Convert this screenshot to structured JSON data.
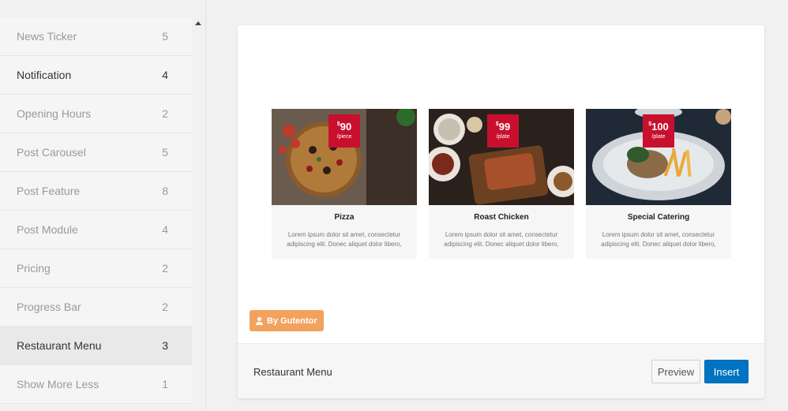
{
  "sidebar": {
    "items": [
      {
        "label": "News Ticker",
        "count": "5"
      },
      {
        "label": "Notification",
        "count": "4"
      },
      {
        "label": "Opening Hours",
        "count": "2"
      },
      {
        "label": "Post Carousel",
        "count": "5"
      },
      {
        "label": "Post Feature",
        "count": "8"
      },
      {
        "label": "Post Module",
        "count": "4"
      },
      {
        "label": "Pricing",
        "count": "2"
      },
      {
        "label": "Progress Bar",
        "count": "2"
      },
      {
        "label": "Restaurant Menu",
        "count": "3"
      },
      {
        "label": "Show More Less",
        "count": "1"
      }
    ],
    "active_item": "Restaurant Menu"
  },
  "preview": {
    "menu_items": [
      {
        "title": "Pizza",
        "currency": "$",
        "price": "90",
        "unit": "/piece",
        "description": "Lorem ipsum dolor sit amet, consectetur adipiscing elit. Donec aliquet dolor libero,"
      },
      {
        "title": "Roast Chicken",
        "currency": "$",
        "price": "99",
        "unit": "/plate",
        "description": "Lorem ipsum dolor sit amet, consectetur adipiscing elit. Donec aliquet dolor libero,"
      },
      {
        "title": "Special Catering",
        "currency": "$",
        "price": "100",
        "unit": "/plate",
        "description": "Lorem ipsum dolor sit amet, consectetur adipiscing elit. Donec aliquet dolor libero,"
      }
    ],
    "author_badge": "By Gutentor"
  },
  "footer": {
    "template_name": "Restaurant Menu",
    "preview_label": "Preview",
    "insert_label": "Insert"
  },
  "colors": {
    "price_tag": "#c8102e",
    "badge": "#f3a25e",
    "insert_button": "#0073c1"
  }
}
